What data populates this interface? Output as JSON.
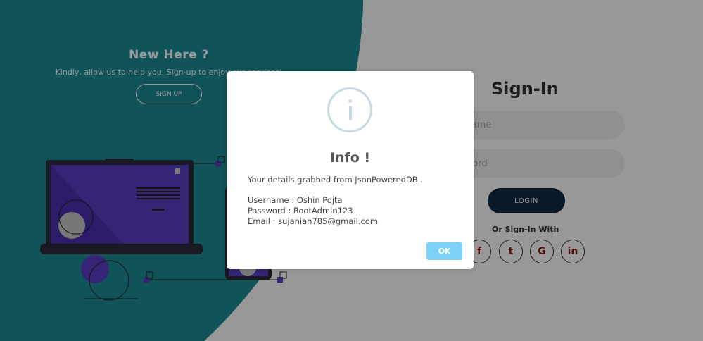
{
  "colors": {
    "teal": "#1b8a93",
    "form_bg": "#f0f0f0",
    "login_bg": "#0f2a3f",
    "ok_bg": "#7cd1f9",
    "social_icon": "#8a1313",
    "illustration_purple": "#5b3cc4"
  },
  "left_panel": {
    "title": "New Here ?",
    "subtitle": "Kindly, allow us to help you. Sign-up to enjoy our services!",
    "signup_label": "SIGN UP"
  },
  "signin": {
    "title": "Sign-In",
    "username_placeholder": "Username",
    "password_placeholder": "Password",
    "login_label": "LOGIN",
    "social_label": "Or Sign-In With",
    "social_icons": [
      "facebook-icon",
      "twitter-icon",
      "google-icon",
      "linkedin-icon"
    ],
    "social_glyphs": [
      "f",
      "t",
      "G",
      "in"
    ]
  },
  "modal": {
    "icon": "info-icon",
    "title": "Info !",
    "message": "Your details grabbed from JsonPoweredDB .",
    "username_line": "Username : Oshin Pojta",
    "password_line": "Password : RootAdmin123",
    "email_line": "Email : sujanian785@gmail.com",
    "ok_label": "OK"
  }
}
